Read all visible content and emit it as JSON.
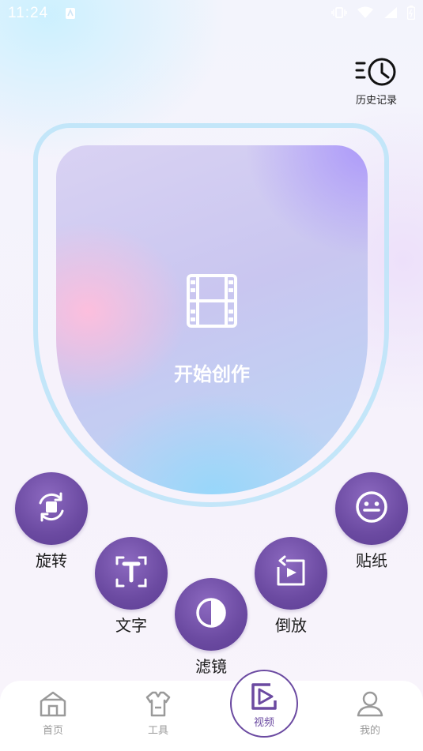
{
  "status_bar": {
    "time": "11:24"
  },
  "header": {
    "history_label": "历史记录"
  },
  "main": {
    "create_label": "开始创作"
  },
  "tools": [
    {
      "label": "旋转",
      "icon": "rotate-icon"
    },
    {
      "label": "文字",
      "icon": "text-icon"
    },
    {
      "label": "滤镜",
      "icon": "filter-icon"
    },
    {
      "label": "倒放",
      "icon": "reverse-play-icon"
    },
    {
      "label": "贴纸",
      "icon": "sticker-icon"
    }
  ],
  "bottom_nav": {
    "items": [
      {
        "label": "首页",
        "icon": "home-icon"
      },
      {
        "label": "工具",
        "icon": "tools-icon"
      },
      {
        "label": "视频",
        "icon": "video-icon",
        "active": true
      },
      {
        "label": "我的",
        "icon": "profile-icon"
      }
    ]
  },
  "colors": {
    "accent": "#6b4aa1",
    "inactive": "#9a9a9a"
  }
}
